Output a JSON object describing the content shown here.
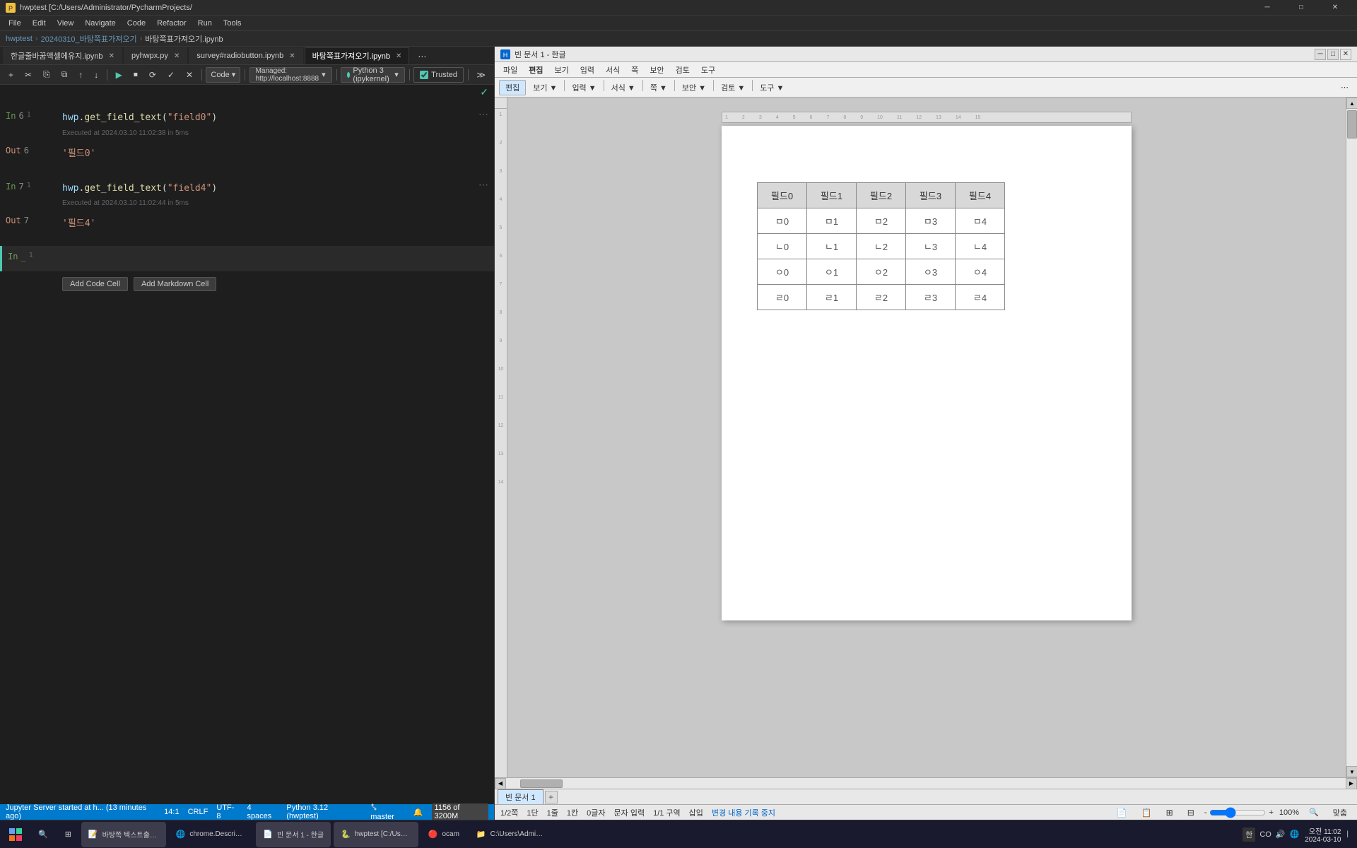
{
  "app": {
    "title": "hwptest [C:/Users/Administrator/PycharmProjects/",
    "window_controls": [
      "minimize",
      "maximize",
      "close"
    ]
  },
  "menu": {
    "items": [
      "File",
      "Edit",
      "View",
      "Navigate",
      "Code",
      "Refactor",
      "Run",
      "Tools"
    ]
  },
  "breadcrumb": {
    "parts": [
      "hwptest",
      "20240310_바탕쪽표가져오기",
      "바탕쪽표가져오기.ipynb"
    ]
  },
  "tabs": [
    {
      "label": "한글줄바꿈액셀에유지.ipynb",
      "active": false
    },
    {
      "label": "pyhwpx.py",
      "active": false
    },
    {
      "label": "survey#radiobutton.ipynb",
      "active": false
    },
    {
      "label": "바탕쪽표가져오기.ipynb",
      "active": true
    }
  ],
  "toolbar": {
    "buttons": [
      "+",
      "✂",
      "⎘",
      "⧉",
      "↑",
      "↓",
      "▶",
      "⏹",
      "⟳",
      "✓",
      "✕"
    ],
    "code_dropdown": "Code",
    "managed_label": "Managed: http://localhost:8888",
    "kernel_label": "Python 3 (ipykernel)",
    "trusted_label": "Trusted"
  },
  "cells": [
    {
      "type": "input",
      "prompt": "In 6 1",
      "prompt_color": "green",
      "code": "hwp.get_field_text(\"field0\")",
      "code_parts": {
        "obj": "hwp",
        "func": "get_field_text",
        "arg": "\"field0\""
      },
      "meta": "Executed at 2024.03.10 11:02:38 in 5ms"
    },
    {
      "type": "output",
      "prompt": "Out 6",
      "prompt_color": "orange",
      "value": "'필드0'"
    },
    {
      "type": "input",
      "prompt": "In 7 1",
      "prompt_color": "green",
      "code": "hwp.get_field_text(\"field4\")",
      "code_parts": {
        "obj": "hwp",
        "func": "get_field_text",
        "arg": "\"field4\""
      },
      "meta": "Executed at 2024.03.10 11:02:44 in 5ms"
    },
    {
      "type": "output",
      "prompt": "Out 7",
      "prompt_color": "orange",
      "value": "'필드4'"
    }
  ],
  "new_cell": {
    "prompt": "In _ 1",
    "add_code_btn": "Add Code Cell",
    "add_markdown_btn": "Add Markdown Cell"
  },
  "status_bar": {
    "left": "Jupyter Server started at h... (13 minutes ago)",
    "position": "14:1",
    "line_ending": "CRLF",
    "encoding": "UTF-8",
    "spaces": "4 spaces",
    "python": "Python 3.12 (hwptest)",
    "branch": "master",
    "memory": "1156 of 3200M"
  },
  "hwp": {
    "title": "빈 문서 1 - 한글",
    "title_controls": [
      "_",
      "□",
      "×"
    ],
    "menu": [
      "파일",
      "편집",
      "보기",
      "입력",
      "서식",
      "쪽",
      "보안",
      "검토",
      "도구"
    ],
    "toolbar": {
      "edit_btn": "편집",
      "view_btn": "보기 ▼",
      "input_btn": "입력 ▼",
      "format_btn": "서식 ▼",
      "page_btn": "쪽 ▼",
      "security_btn": "보안 ▼",
      "review_btn": "검토 ▼",
      "tools_btn": "도구 ▼"
    },
    "table": {
      "headers": [
        "필드0",
        "필드1",
        "필드2",
        "필드3",
        "필드4"
      ],
      "rows": [
        [
          "ㅁ0",
          "ㅁ1",
          "ㅁ2",
          "ㅁ3",
          "ㅁ4"
        ],
        [
          "ㄴ0",
          "ㄴ1",
          "ㄴ2",
          "ㄴ3",
          "ㄴ4"
        ],
        [
          "ㅇ0",
          "ㅇ1",
          "ㅇ2",
          "ㅇ3",
          "ㅇ4"
        ],
        [
          "ㄹ0",
          "ㄹ1",
          "ㄹ2",
          "ㄹ3",
          "ㄹ4"
        ]
      ]
    },
    "bottom_tab": "빈 문서 1",
    "status": {
      "page": "1/2쪽",
      "section": "1단",
      "line": "1줄",
      "col": "1칸",
      "char_count": "0글자",
      "insert_mode": "문자 입력",
      "section_num": "1/1 구역",
      "insert": "삽입",
      "track_changes": "변경 내용 기록 중지",
      "zoom": "100%"
    }
  },
  "taskbar": {
    "apps": [
      {
        "label": "바탕쪽 텍스트출력, 표인",
        "icon": "📝"
      },
      {
        "label": "chrome.Descriptors-UI",
        "icon": "🌐"
      },
      {
        "label": "빈 문서 1 - 한글",
        "icon": "📄"
      },
      {
        "label": "hwptest [C:/Users/Admi",
        "icon": "🐍"
      },
      {
        "label": "ocam",
        "icon": "🔴"
      },
      {
        "label": "C:\\Users\\Administrator\\",
        "icon": "📁"
      }
    ],
    "sys_tray": {
      "time": "오전 11:02",
      "date": "2024-03-10",
      "icons": [
        "🔊",
        "🌐",
        "⌨",
        "한"
      ]
    }
  }
}
